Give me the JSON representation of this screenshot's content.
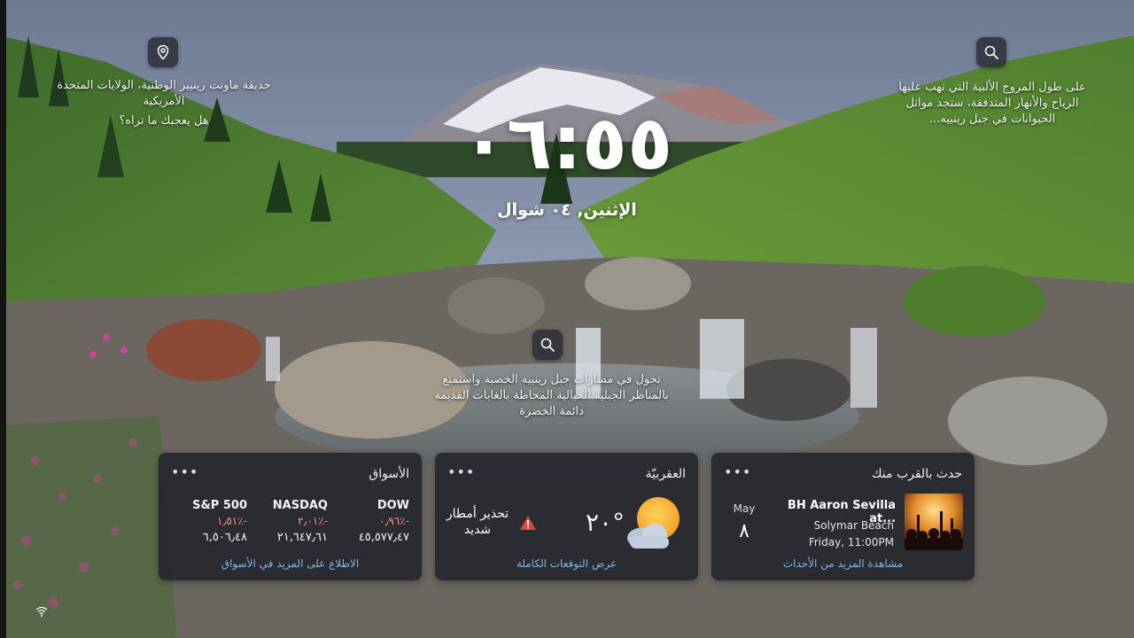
{
  "colors": {
    "link": "#7fb4e8",
    "market_negative": "#ff9a8c",
    "widget_bg": "#24262c"
  },
  "clock": {
    "time": "٠٦:٥٥",
    "date": "الإثنين, ٠٤ شوال"
  },
  "hotspots": {
    "location": {
      "icon": "location-pin-icon",
      "title": "حديقة ماونت رينيير الوطنية، الولايات المتحدة الأمريكية",
      "prompt": "هل يعجبك ما تراه؟"
    },
    "top_right": {
      "icon": "search-icon",
      "text": "على طول المروج الألبية التي تهب عليها الرياح والأنهار المتدفقة، ستجد مواثل الحيوانات في جبل رينييه..."
    },
    "center": {
      "icon": "search-icon",
      "text": "تجول في مسارات جبل رينييه الخصبة واستمتع بالمناظر الجبلية الخيالية المحاطة بالغابات القديمة دائمة الخضرة"
    }
  },
  "widgets": {
    "markets": {
      "title": "الأسواق",
      "more": "•••",
      "items": [
        {
          "name": "DOW",
          "change": "٠٫٩٦٪-",
          "value": "٤٥,٥٧٧٫٤٧"
        },
        {
          "name": "NASDAQ",
          "change": "٢٫٠١٪-",
          "value": "٢١,٦٤٧٫٦١"
        },
        {
          "name": "S&P 500",
          "change": "١٫٥١٪-",
          "value": "٦,٥٠٦٫٤٨"
        }
      ],
      "link": "الاطلاع على المزيد في الأسواق"
    },
    "weather": {
      "title": "العقربيّة",
      "more": "•••",
      "temperature": "٢٠°",
      "icon": "partly-cloudy-icon",
      "alert_icon": "warning-icon",
      "alert": "تحذير أمطار شديد",
      "link": "عرض التوقعات الكاملة"
    },
    "events": {
      "title": "حدث بالقرب منك",
      "more": "•••",
      "month": "May",
      "day": "٨",
      "event_title": "BH Aaron Sevilla at...",
      "place": "Solymar Beach",
      "time": "Friday, 11:00PM",
      "thumbnail": "concert-crowd-image",
      "link": "مشاهدة المزيد من الأحداث"
    }
  }
}
